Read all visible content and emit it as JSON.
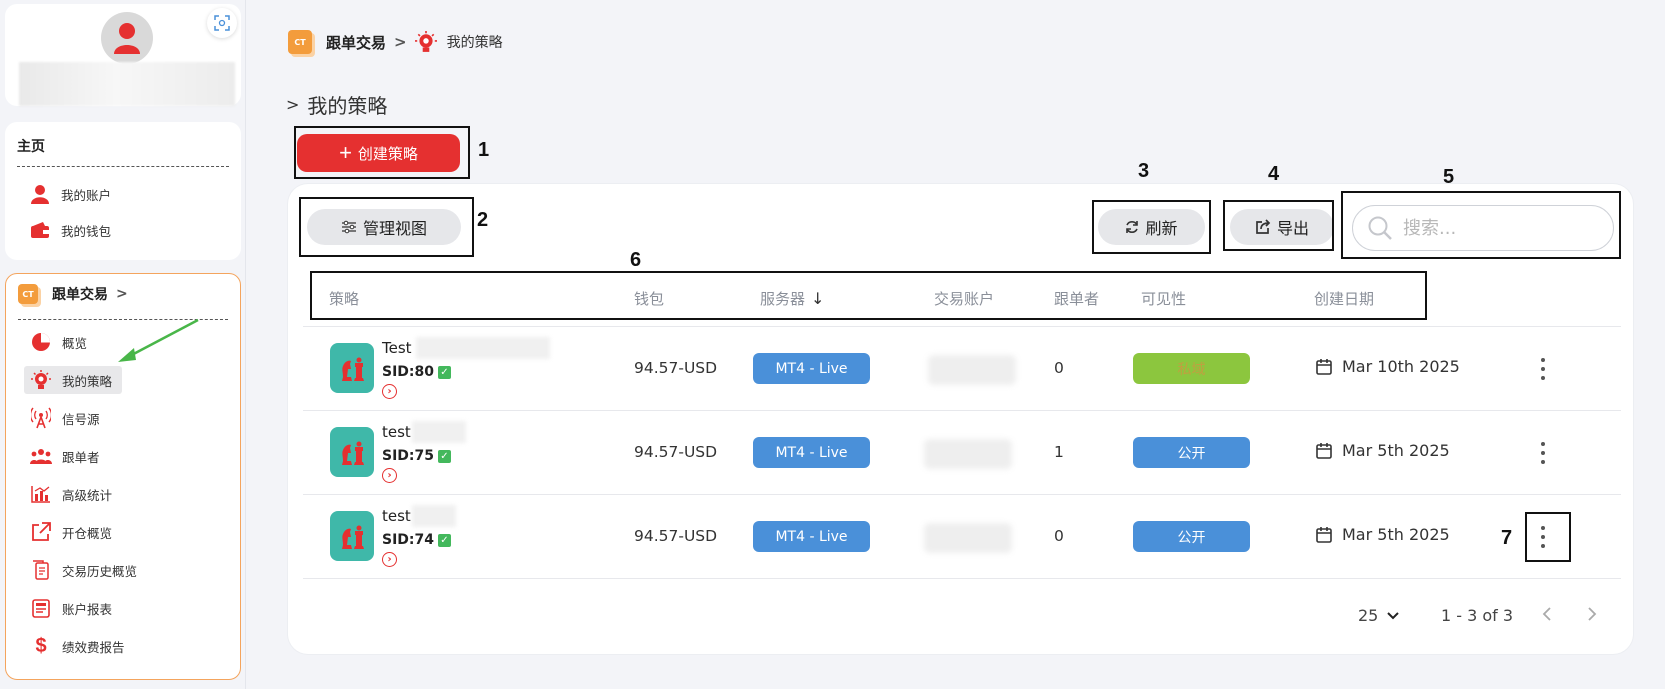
{
  "sidebar": {
    "home_title": "主页",
    "home_items": [
      {
        "label": "我的账户",
        "icon": "user-icon"
      },
      {
        "label": "我的钱包",
        "icon": "wallet-icon"
      }
    ],
    "copy_title": "跟单交易",
    "copy_logo": "CT",
    "copy_items": [
      {
        "label": "概览",
        "icon": "pie-chart-icon"
      },
      {
        "label": "我的策略",
        "icon": "lightbulb-icon"
      },
      {
        "label": "信号源",
        "icon": "signal-tower-icon"
      },
      {
        "label": "跟单者",
        "icon": "group-icon"
      },
      {
        "label": "高级统计",
        "icon": "bar-chart-icon"
      },
      {
        "label": "开仓概览",
        "icon": "external-link-icon"
      },
      {
        "label": "交易历史概览",
        "icon": "history-doc-icon"
      },
      {
        "label": "账户报表",
        "icon": "report-icon"
      },
      {
        "label": "绩效费报告",
        "icon": "dollar-icon"
      }
    ]
  },
  "breadcrumb": {
    "logo": "CT",
    "root": "跟单交易",
    "separator": ">",
    "current": "我的策略"
  },
  "page": {
    "title": "我的策略",
    "create_button": "创建策略"
  },
  "toolbar": {
    "manage_view": "管理视图",
    "refresh": "刷新",
    "export": "导出",
    "search_placeholder": "搜索..."
  },
  "annotations": [
    "1",
    "2",
    "3",
    "4",
    "5",
    "6",
    "7"
  ],
  "table": {
    "headers": [
      "策略",
      "钱包",
      "服务器",
      "交易账户",
      "跟单者",
      "可见性",
      "创建日期"
    ],
    "sort_indicator": "↓",
    "rows": [
      {
        "name": "Test",
        "sid": "SID:80",
        "wallet": "94.57-USD",
        "server": "MT4 - Live",
        "followers": "0",
        "visibility": "私域",
        "visibility_color": "#8cc63e",
        "date": "Mar 10th 2025"
      },
      {
        "name": "test",
        "sid": "SID:75",
        "wallet": "94.57-USD",
        "server": "MT4 - Live",
        "followers": "1",
        "visibility": "公开",
        "visibility_color": "#4a90d9",
        "date": "Mar 5th 2025"
      },
      {
        "name": "test",
        "sid": "SID:74",
        "wallet": "94.57-USD",
        "server": "MT4 - Live",
        "followers": "0",
        "visibility": "公开",
        "visibility_color": "#4a90d9",
        "date": "Mar 5th 2025"
      }
    ]
  },
  "pagination": {
    "page_size": "25",
    "range": "1 - 3 of 3"
  },
  "colors": {
    "accent_red": "#e53030",
    "server_blue": "#4a90d9",
    "orange": "#f39c3c",
    "teal": "#3fb8a9"
  }
}
